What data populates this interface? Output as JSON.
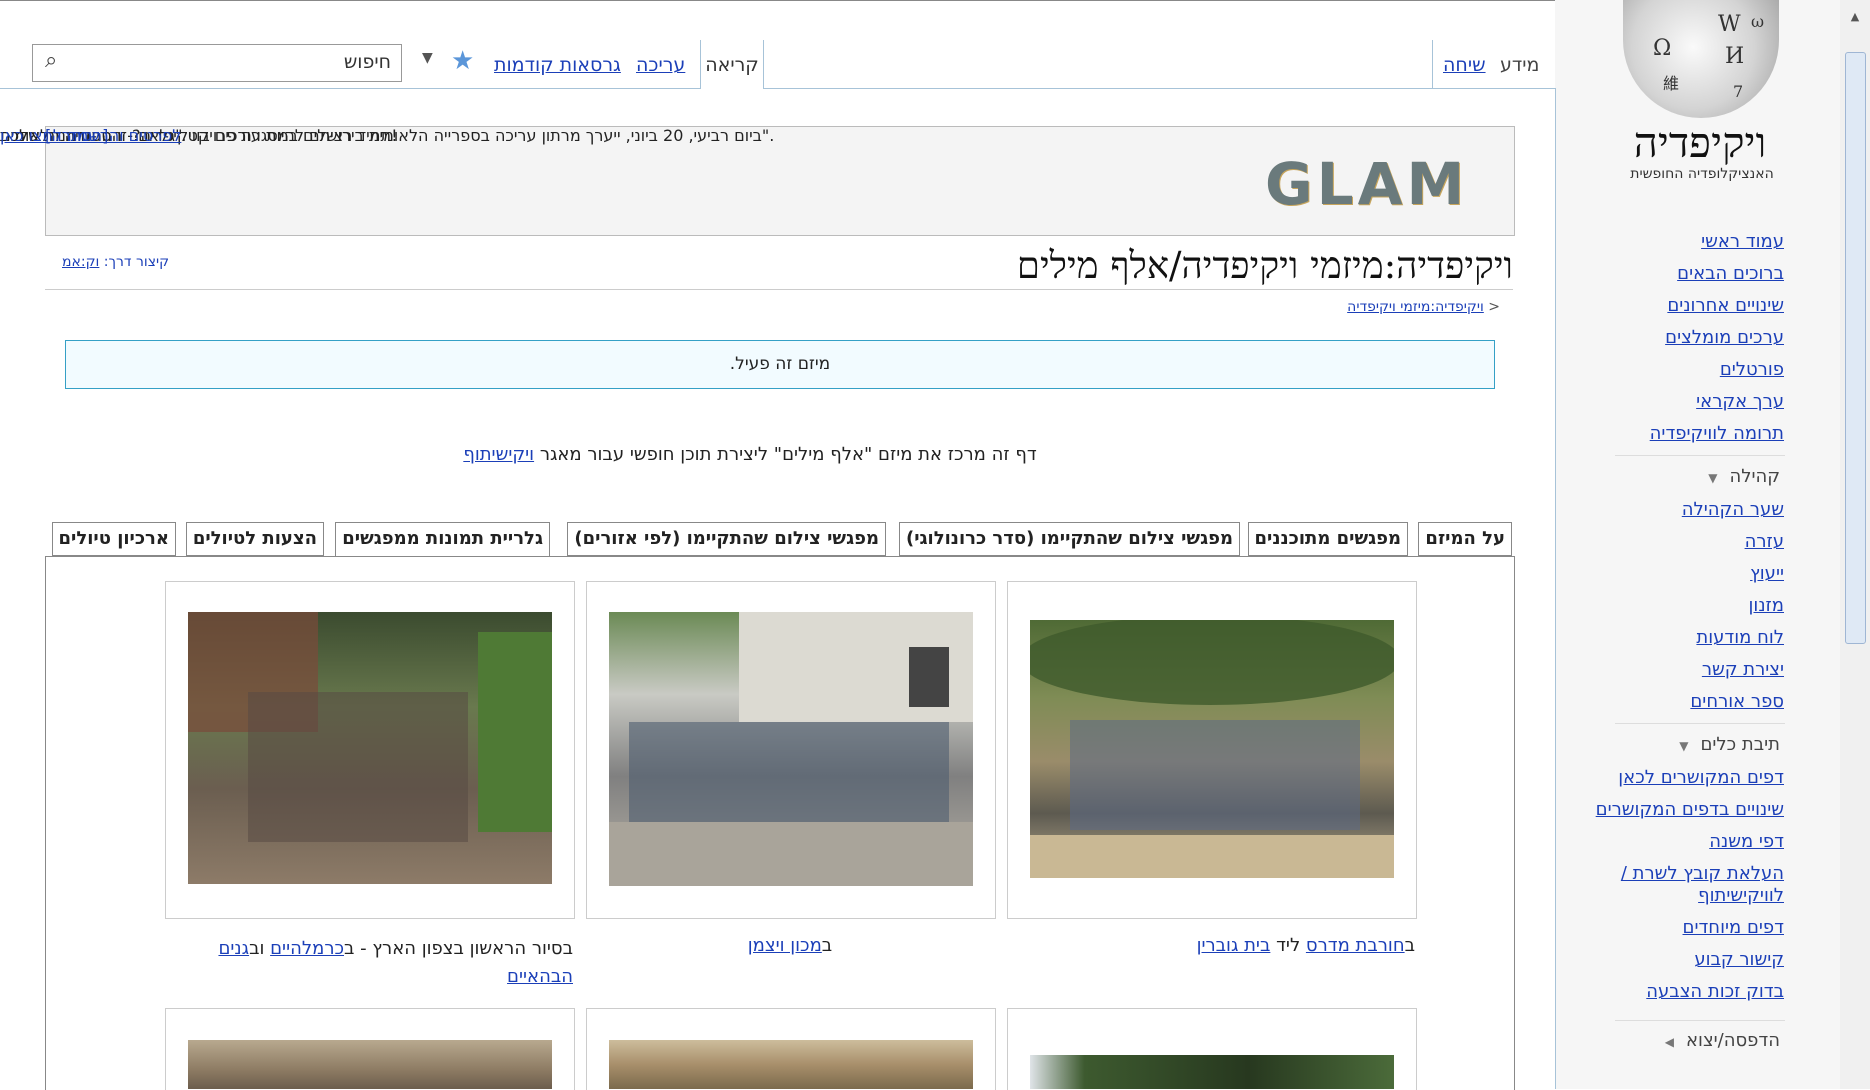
{
  "head_tabs": {
    "info": "מידע",
    "talk": "שיחה",
    "read": "קריאה",
    "edit": "עריכה",
    "history": "גרסאות קודמות",
    "search_placeholder": "חיפוש"
  },
  "logo": {
    "wordmark": "ויקיפדיה",
    "tagline": "האנציקלופדיה החופשית",
    "glyphs": [
      "Ω",
      "W",
      "И",
      "維",
      "ω",
      "7"
    ]
  },
  "sidebar": {
    "nav": [
      "עמוד ראשי",
      "ברוכים הבאים",
      "שינויים אחרונים",
      "ערכים מומלצים",
      "פורטלים",
      "ערך אקראי",
      "תרומה לוויקיפדיה"
    ],
    "community_title": "קהילה",
    "community": [
      "שער הקהילה",
      "עזרה",
      "ייעוץ",
      "מזנון",
      "לוח מודעות",
      "יצירת קשר",
      "ספר אורחים"
    ],
    "tools_title": "תיבת כלים",
    "tools": [
      "דפים המקושרים לכאן",
      "שינויים בדפים המקושרים",
      "דפי משנה",
      "העלאת קובץ לשרת / לוויקישיתוף",
      "דפים מיוחדים",
      "קישור קבוע",
      "בדוק זכות הצבעה"
    ],
    "print_title": "הדפסה/יצוא"
  },
  "banner": {
    "logo": "GLAM",
    "line1": "תמיד רציתם להיות עורכים בוויקיפדיה? זו ההזדמנות שלכם!",
    "line2": "ביום רביעי, 20 ביוני, ייערך מרתון עריכה בספרייה הלאומית בירושלים במסגרת פרויקט \"גלאם - הספרייה הלאומית\".",
    "line3_link": "לפרטים והרשמה לחצו כאן",
    "line3_end": ".",
    "hide": "[הסתרה]"
  },
  "page": {
    "title": "ויקיפדיה:מיזמי ויקיפדיה/אלף מילים",
    "shortcut_label": "קיצור דרך:",
    "shortcut_link": "וק:אמ",
    "breadcrumb_arrow": "<",
    "breadcrumb": "ויקיפדיה:מיזמי ויקיפדיה",
    "active_notice": "מיזם זה פעיל.",
    "description_text": "דף זה מרכז את מיזם \"אלף מילים\" ליצירת תוכן חופשי עבור מאגר",
    "description_link": "ויקישיתוף"
  },
  "project_tabs": [
    "על המיזם",
    "מפגשים מתוכננים",
    "מפגשי צילום שהתקיימו (סדר כרונולוגי)",
    "מפגשי צילום שהתקיימו (לפי אזורים)",
    "גלריית תמונות ממפגשים",
    "הצעות לטיולים",
    "ארכיון טיולים"
  ],
  "gallery": {
    "captions": [
      {
        "p1": "ב",
        "l1": "חורבת מדרס",
        "p2": " ליד ",
        "l2": "בית גוברין"
      },
      {
        "p1": "ב",
        "l1": "מכון ויצמן"
      },
      {
        "p1": "בסיור הראשון בצפון הארץ - ב",
        "l1": "כרמלהיים",
        "p2": " וב",
        "l2": "גנים הבהאיים"
      }
    ]
  },
  "colors": {
    "link": "#1b3fb8",
    "accent": "#35a0c6",
    "sidebar_bg": "#f6f6f6"
  }
}
